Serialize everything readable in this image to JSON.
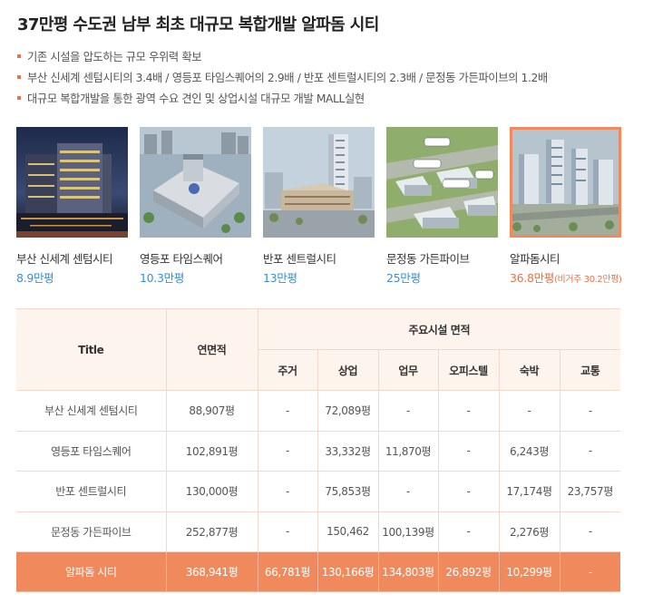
{
  "title": "37만평 수도권 남부 최초 대규모 복합개발 알파돔 시티",
  "bullets": [
    "기존 시설을 압도하는 규모 우위력 확보",
    "부산 신세계 센텀시티의 3.4배 / 영등포 타임스퀘어의 2.9배 / 반포 센트럴시티의 2.3배 / 문정동 가든파이브의 1.2배",
    "대규모 복합개발을 통한 광역 수요 견인 및 상업시설 대규모 개발 MALL실현"
  ],
  "cards": [
    {
      "name": "부산 신세계 센텀시티",
      "size": "8.9만평",
      "note": "",
      "picture": "department-store-night-photo"
    },
    {
      "name": "영등포 타임스퀘어",
      "size": "10.3만평",
      "note": "",
      "picture": "mall-aerial-rendering"
    },
    {
      "name": "반포 센트럴시티",
      "size": "13만평",
      "note": "",
      "picture": "terminal-tower-rendering"
    },
    {
      "name": "문정동 가든파이브",
      "size": "25만평",
      "note": "",
      "picture": "complex-map-rendering"
    },
    {
      "name": "알파돔시티",
      "size": "36.8만평",
      "note": "(비거주 30.2만평)",
      "picture": "alphadom-city-rendering"
    }
  ],
  "table": {
    "col_title": "Title",
    "col_area": "연면적",
    "col_group": "주요시설 면적",
    "subcols": [
      "주거",
      "상업",
      "업무",
      "오피스텔",
      "숙박",
      "교통"
    ],
    "rows": [
      {
        "name": "부산 신세계 센텀시티",
        "area": "88,907평",
        "cells": [
          "-",
          "72,089평",
          "-",
          "-",
          "-",
          "-"
        ]
      },
      {
        "name": "영등포 타임스퀘어",
        "area": "102,891평",
        "cells": [
          "-",
          "33,332평",
          "11,870평",
          "-",
          "6,243평",
          "-"
        ]
      },
      {
        "name": "반포 센트럴시티",
        "area": "130,000평",
        "cells": [
          "-",
          "75,853평",
          "-",
          "-",
          "17,174평",
          "23,757평"
        ]
      },
      {
        "name": "문정동 가든파이브",
        "area": "252,877평",
        "cells": [
          "-",
          "150,462",
          "100,139평",
          "-",
          "2,276평",
          "-"
        ]
      },
      {
        "name": "알파돔 시티",
        "area": "368,941평",
        "cells": [
          "66,781평",
          "130,166평",
          "134,803평",
          "26,892평",
          "10,299평",
          "-"
        ],
        "highlight": true
      }
    ]
  },
  "colors": {
    "accent": "#f08a5d",
    "link_blue": "#3a8fd6",
    "header_bg": "#fdf4ee"
  }
}
